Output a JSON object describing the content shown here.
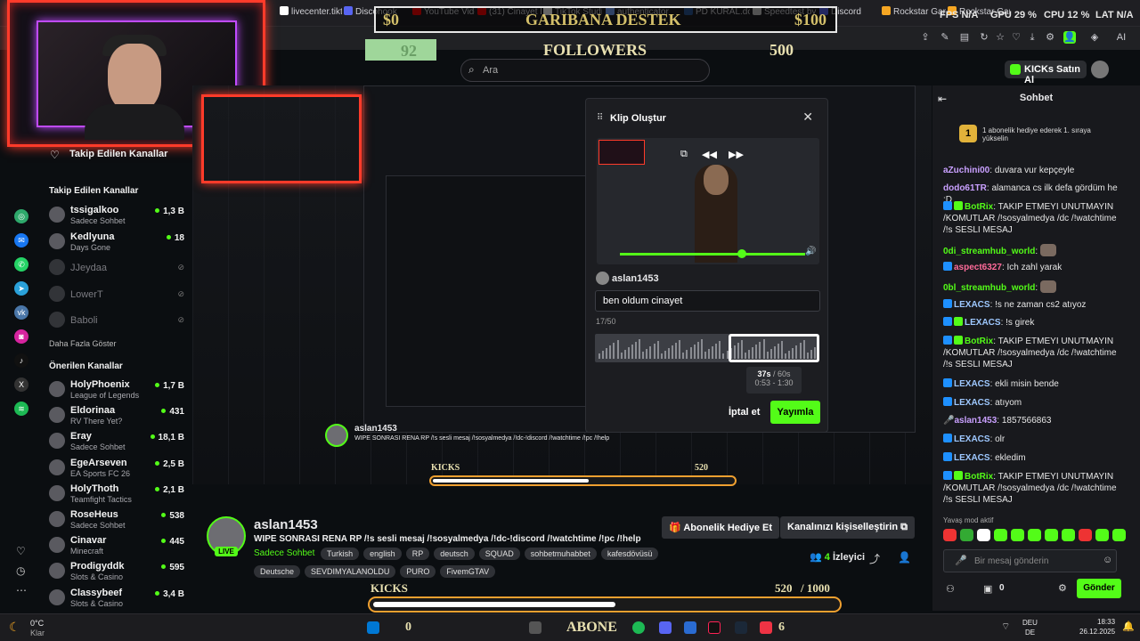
{
  "browser": {
    "tabs": [
      {
        "label": "livecenter.tikto",
        "color": "#ffffff"
      },
      {
        "label": "Discohook",
        "color": "#5865f2"
      },
      {
        "label": "YouTube Video",
        "color": "#ff0000"
      },
      {
        "label": "(31) Cinayet B",
        "color": "#ff0000"
      },
      {
        "label": "TikTok Studio",
        "color": "#ffffff"
      },
      {
        "label": "authenticator",
        "color": "#7aa7ff"
      },
      {
        "label": "PD KURAL.docx",
        "color": "#2b579a"
      },
      {
        "label": "Speedtest by",
        "color": "#cccccc"
      },
      {
        "label": "Discord",
        "color": "#5865f2"
      },
      {
        "label": "Rockstar Gam",
        "color": "#f5a623"
      },
      {
        "label": "Rockstar Gam",
        "color": "#f5a623"
      }
    ],
    "perf": [
      "FPS N/A",
      "GPU 29 %",
      "CPU 12 %",
      "LAT N/A"
    ]
  },
  "overlay": {
    "donate_left": "$0",
    "donate_title": "GARIBANA DESTEK",
    "donate_right": "$100",
    "followers_count": "92",
    "followers_label": "FOLLOWERS",
    "followers_goal": "500",
    "kicks_label": "KICKS",
    "kicks_value": "520",
    "kicks_goal": "/ 1000",
    "kicks_progress": 0.52,
    "abone": "ABONE",
    "abone_left": "0",
    "abone_right": "6"
  },
  "header": {
    "search_placeholder": "Ara",
    "kicks_button": "KICKs Satın Al"
  },
  "sidebar": {
    "title": "Takip Edilen Kanallar",
    "followed_heading": "Takip Edilen Kanallar",
    "followed": [
      {
        "name": "tssigalkoo",
        "sub": "Sadece Sohbet",
        "count": "1,3 B",
        "online": true
      },
      {
        "name": "Kedlyuna",
        "sub": "Days Gone",
        "count": "18",
        "online": true
      },
      {
        "name": "JJeydaa",
        "sub": "",
        "count": "",
        "online": false
      },
      {
        "name": "LowerT",
        "sub": "",
        "count": "",
        "online": false
      },
      {
        "name": "Baboli",
        "sub": "",
        "count": "",
        "online": false
      }
    ],
    "more_label": "Daha Fazla Göster",
    "recommended_heading": "Önerilen Kanallar",
    "recommended": [
      {
        "name": "HolyPhoenix",
        "sub": "League of Legends",
        "count": "1,7 B"
      },
      {
        "name": "Eldorinaa",
        "sub": "RV There Yet?",
        "count": "431"
      },
      {
        "name": "Eray",
        "sub": "Sadece Sohbet",
        "count": "18,1 B"
      },
      {
        "name": "EgeArseven",
        "sub": "EA Sports FC 26",
        "count": "2,5 B"
      },
      {
        "name": "HolyThoth",
        "sub": "Teamfight Tactics",
        "count": "2,1 B"
      },
      {
        "name": "RoseHeus",
        "sub": "Sadece Sohbet",
        "count": "538"
      },
      {
        "name": "Cinavar",
        "sub": "Minecraft",
        "count": "445"
      },
      {
        "name": "Prodigyddk",
        "sub": "Slots & Casino",
        "count": "595"
      },
      {
        "name": "Classybeef",
        "sub": "Slots & Casino",
        "count": "3,4 B"
      }
    ]
  },
  "clip": {
    "title": "Klip Oluştur",
    "username": "aslan1453",
    "input_value": "ben oldum cinayet",
    "char_count": "17/50",
    "duration": "37s",
    "max": "/ 60s",
    "range": "0:53 - 1:30",
    "cancel": "İptal et",
    "publish": "Yayımla"
  },
  "stream": {
    "name": "aslan1453",
    "live": "LIVE",
    "title": "WIPE SONRASI RENA RP /!s sesli mesaj /!sosyalmedya  /!dc-!discord /!watchtime /!pc /!help",
    "category": "Sadece Sohbet",
    "tags_row1": [
      "Turkish",
      "english",
      "RP",
      "deutsch",
      "SQUAD",
      "sohbetmuhabbet",
      "kafesdövüsü"
    ],
    "tags_row2": [
      "Deutsche",
      "SEVDIMYALANOLDU",
      "PURO",
      "FivemGTAV"
    ],
    "gift_button": "Abonelik Hediye Et",
    "customize_button": "Kanalınızı kişiselleştirin",
    "viewers_count": "4",
    "viewers_label": "İzleyici"
  },
  "chat": {
    "title": "Sohbet",
    "goal_text": "1 abonelik hediye ederek 1. sıraya yükselin",
    "messages": [
      {
        "user": "aZuchini00",
        "text": "duvara vur kepçeyle",
        "color": "#c9a0ff",
        "badge": ""
      },
      {
        "user": "dodo61TR",
        "text": "alamanca cs ilk defa gördüm he :D",
        "color": "#c9a0ff",
        "badge": ""
      },
      {
        "user": "BotRix",
        "text": "TAKIP ETMEYI UNUTMAYIN /KOMUTLAR /!sosyalmedya /dc /!watchtime /!s SESLI MESAJ",
        "color": "#53fc18",
        "badge": "both"
      },
      {
        "user": "0di_streamhub_world",
        "text": "",
        "color": "#53fc18",
        "badge": "",
        "emote": true
      },
      {
        "user": "aspect6327",
        "text": "Ich zahl yarak",
        "color": "#ff6b9a",
        "badge": "blue"
      },
      {
        "user": "0bl_streamhub_world",
        "text": "",
        "color": "#53fc18",
        "badge": "",
        "emote": true
      },
      {
        "user": "LEXACS",
        "text": "!s ne zaman cs2 atıyoz",
        "color": "#9ec8ff",
        "badge": "blue"
      },
      {
        "user": "LEXACS",
        "text": "!s girek",
        "color": "#9ec8ff",
        "badge": "both"
      },
      {
        "user": "BotRix",
        "text": "TAKIP ETMEYI UNUTMAYIN /KOMUTLAR /!sosyalmedya /dc /!watchtime /!s SESLI MESAJ",
        "color": "#53fc18",
        "badge": "both"
      },
      {
        "user": "LEXACS",
        "text": "ekli misin bende",
        "color": "#9ec8ff",
        "badge": "blue"
      },
      {
        "user": "LEXACS",
        "text": "atıyom",
        "color": "#9ec8ff",
        "badge": "blue"
      },
      {
        "user": "aslan1453",
        "text": "1857566863",
        "color": "#c9a0ff",
        "badge": "mic"
      },
      {
        "user": "LEXACS",
        "text": "olr",
        "color": "#9ec8ff",
        "badge": "blue"
      },
      {
        "user": "LEXACS",
        "text": "ekledim",
        "color": "#9ec8ff",
        "badge": "blue"
      },
      {
        "user": "BotRix",
        "text": "TAKIP ETMEYI UNUTMAYIN /KOMUTLAR /!sosyalmedya /dc /!watchtime /!s SESLI MESAJ",
        "color": "#53fc18",
        "badge": "both"
      }
    ],
    "slow_mode": "Yavaş mod aktif",
    "input_placeholder": "Bir mesaj gönderin",
    "kicks_count": "0",
    "send": "Gönder"
  },
  "taskbar": {
    "temp": "0°C",
    "weather": "Klar",
    "lang_top": "DEU",
    "lang_bottom": "DE",
    "time": "18:33",
    "date": "26.12.2025"
  }
}
